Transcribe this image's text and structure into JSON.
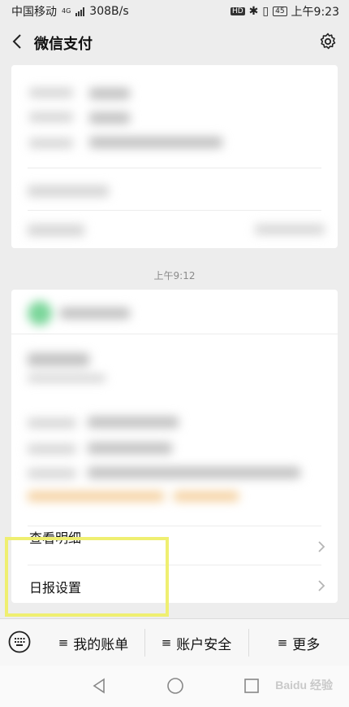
{
  "status_bar": {
    "carrier": "中国移动",
    "network": "4G",
    "speed": "308B/s",
    "hd_badge": "HD",
    "battery": "45",
    "time": "上午9:23"
  },
  "header": {
    "title": "微信支付"
  },
  "messages": {
    "timestamp": "上午9:12"
  },
  "card_rows": {
    "view_details": "查看明细",
    "daily_report_settings": "日报设置"
  },
  "menu": {
    "items": [
      {
        "label": "我的账单"
      },
      {
        "label": "账户安全"
      },
      {
        "label": "更多"
      }
    ]
  },
  "watermark": "Baidu 经验",
  "colors": {
    "highlight": "#efef71",
    "background": "#ededed"
  }
}
